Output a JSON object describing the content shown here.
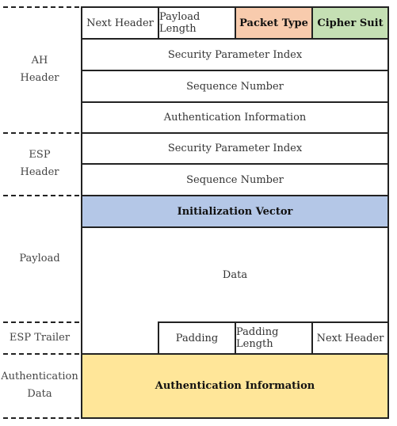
{
  "sections": [
    {
      "label_line1": "AH",
      "label_line2": "Header"
    },
    {
      "label_line1": "ESP",
      "label_line2": "Header"
    },
    {
      "label_line1": "Payload"
    },
    {
      "label_line1": "ESP Trailer"
    },
    {
      "label_line1": "Authentication",
      "label_line2": "Data"
    }
  ],
  "ah": {
    "row1": [
      "Next Header",
      "Payload Length",
      "Packet Type",
      "Cipher Suit"
    ],
    "spi": "Security Parameter Index",
    "seq": "Sequence Number",
    "auth": "Authentication Information"
  },
  "esp": {
    "spi": "Security Parameter Index",
    "seq": "Sequence Number"
  },
  "payload": {
    "iv": "Initialization Vector",
    "data": "Data"
  },
  "trailer": [
    "Padding",
    "Padding Length",
    "Next Header"
  ],
  "auth_data": {
    "label": "Authentication Information"
  },
  "colors": {
    "packet_type": "#f8cbad",
    "cipher_suit": "#c5e0b4",
    "iv": "#b4c7e7",
    "auth_data": "#ffe699"
  }
}
